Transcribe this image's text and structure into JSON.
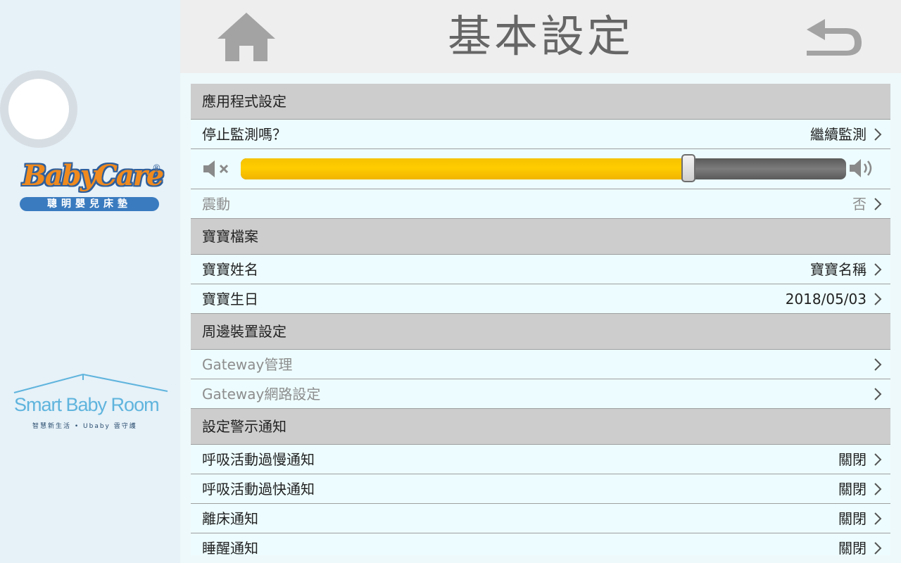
{
  "header": {
    "title": "基本設定"
  },
  "sidebar": {
    "brand": {
      "logo_text": "BabyCare",
      "logo_mark": "®",
      "tagline": "聰明嬰兒床墊"
    },
    "partner": {
      "logo_text": "Smart Baby Room",
      "tagline": "智慧新生活 • Ubaby 雲守護"
    }
  },
  "sections": {
    "app": {
      "title": "應用程式設定",
      "stop_monitor": {
        "label": "停止監測嗎？",
        "value": "繼續監測"
      },
      "volume": {
        "level": 0.74
      },
      "vibration": {
        "label": "震動",
        "value": "否"
      }
    },
    "baby": {
      "title": "寶寶檔案",
      "name": {
        "label": "寶寶姓名",
        "value": "寶寶名稱"
      },
      "birthday": {
        "label": "寶寶生日",
        "value": "2018/05/03"
      }
    },
    "devices": {
      "title": "周邊裝置設定",
      "gateway_manage": {
        "label": "Gateway管理",
        "value": ""
      },
      "gateway_network": {
        "label": "Gateway網路設定",
        "value": ""
      }
    },
    "alerts": {
      "title": "設定警示通知",
      "slow_breath": {
        "label": "呼吸活動過慢通知",
        "value": "關閉"
      },
      "fast_breath": {
        "label": "呼吸活動過快通知",
        "value": "關閉"
      },
      "leave_bed": {
        "label": "離床通知",
        "value": "關閉"
      },
      "wake_up": {
        "label": "睡醒通知",
        "value": "關閉"
      }
    }
  },
  "colors": {
    "accent": "#ffcc00",
    "section_bg": "#cdcdcd",
    "row_bg": "#edfcfe",
    "sidebar_bg": "#e6f1f8"
  },
  "icons": {
    "home": "home-icon",
    "back": "back-arrow-icon",
    "mute": "mute-icon",
    "volume": "volume-icon",
    "chevron": "chevron-right-icon"
  }
}
